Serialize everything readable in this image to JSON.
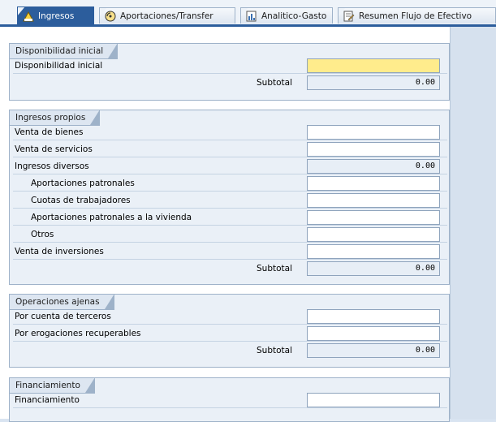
{
  "tabs": [
    {
      "label": "Ingresos",
      "icon": "income-report-icon",
      "active": true
    },
    {
      "label": "Aportaciones/Transfer",
      "icon": "disc-icon",
      "active": false
    },
    {
      "label": "Analitico-Gasto",
      "icon": "bar-chart-icon",
      "active": false
    },
    {
      "label": "Resumen Flujo de Efectivo",
      "icon": "document-edit-icon",
      "active": false
    }
  ],
  "sections": {
    "disponibilidad": {
      "title": "Disponibilidad inicial",
      "rows": [
        {
          "label": "Disponibilidad inicial",
          "value": ""
        }
      ],
      "subtotal_label": "Subtotal",
      "subtotal": "0.00"
    },
    "ingresos_propios": {
      "title": "Ingresos propios",
      "rows": [
        {
          "label": "Venta de bienes",
          "value": ""
        },
        {
          "label": "Venta de servicios",
          "value": ""
        },
        {
          "label": "Ingresos diversos",
          "value": "0.00"
        },
        {
          "label": "Aportaciones patronales",
          "value": ""
        },
        {
          "label": "Cuotas de trabajadores",
          "value": ""
        },
        {
          "label": "Aportaciones patronales a la vivienda",
          "value": ""
        },
        {
          "label": "Otros",
          "value": ""
        },
        {
          "label": "Venta de inversiones",
          "value": ""
        }
      ],
      "subtotal_label": "Subtotal",
      "subtotal": "0.00"
    },
    "operaciones_ajenas": {
      "title": "Operaciones ajenas",
      "rows": [
        {
          "label": "Por cuenta de terceros",
          "value": ""
        },
        {
          "label": "Por erogaciones recuperables",
          "value": ""
        }
      ],
      "subtotal_label": "Subtotal",
      "subtotal": "0.00"
    },
    "financiamiento": {
      "title": "Financiamiento",
      "rows": [
        {
          "label": "Financiamiento",
          "value": ""
        }
      ]
    }
  },
  "colors": {
    "active_tab": "#2c5d9c",
    "highlight_field": "#ffec8c",
    "panel": "#eaf0f7"
  }
}
